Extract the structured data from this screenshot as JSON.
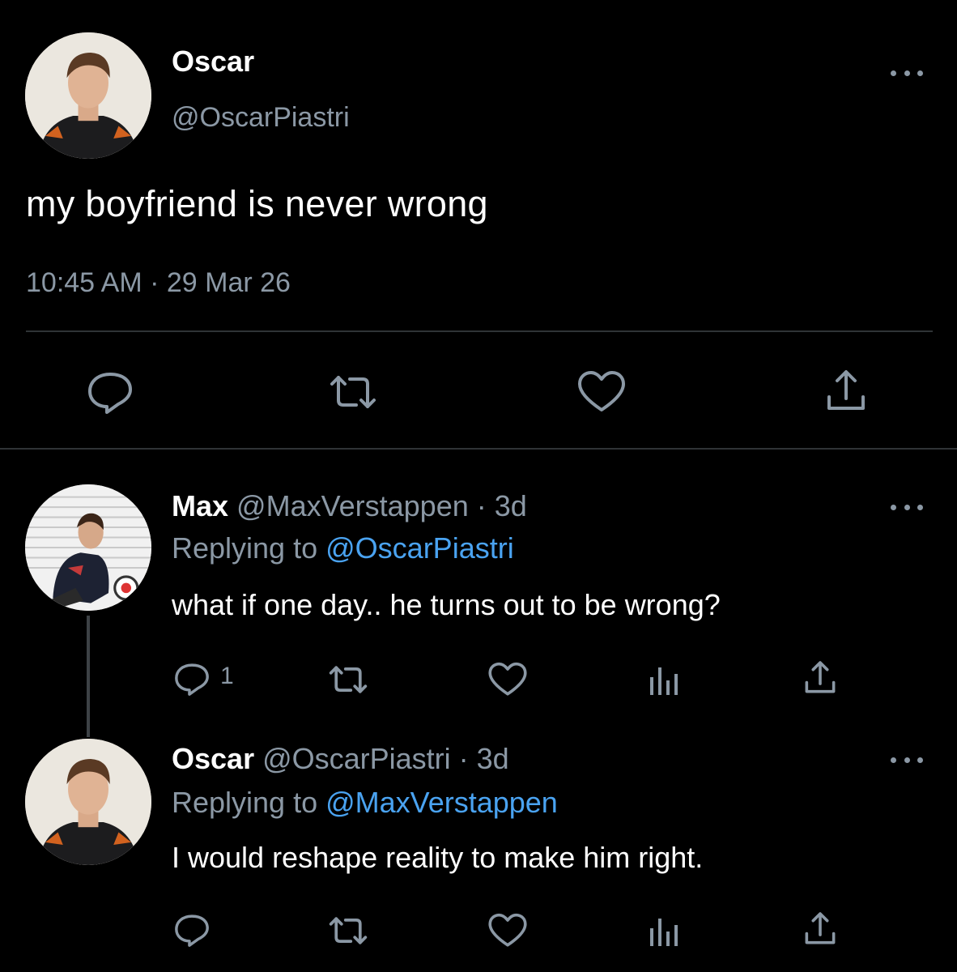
{
  "main_tweet": {
    "author_name": "Oscar",
    "author_handle": "@OscarPiastri",
    "text": "my boyfriend is never wrong",
    "timestamp": "10:45 AM · 29 Mar 26"
  },
  "replies": [
    {
      "author_name": "Max",
      "meta": "@MaxVerstappen · 3d",
      "replying_prefix": "Replying to",
      "replying_to": "@OscarPiastri",
      "text": "what if one day.. he turns out to be wrong?",
      "reply_count": "1"
    },
    {
      "author_name": "Oscar",
      "meta": "@OscarPiastri · 3d",
      "replying_prefix": "Replying to",
      "replying_to": "@MaxVerstappen",
      "text": "I would reshape reality to make him right.",
      "reply_count": ""
    }
  ],
  "icons": {
    "reply": "speech-bubble-icon",
    "retweet": "retweet-icon",
    "like": "heart-icon",
    "share": "share-upload-icon",
    "analytics": "bar-chart-icon",
    "more": "more-dots-icon"
  },
  "colors": {
    "background": "#000000",
    "text": "#ffffff",
    "muted": "#8b98a5",
    "link": "#4aa3f1",
    "divider": "#2f3336"
  }
}
